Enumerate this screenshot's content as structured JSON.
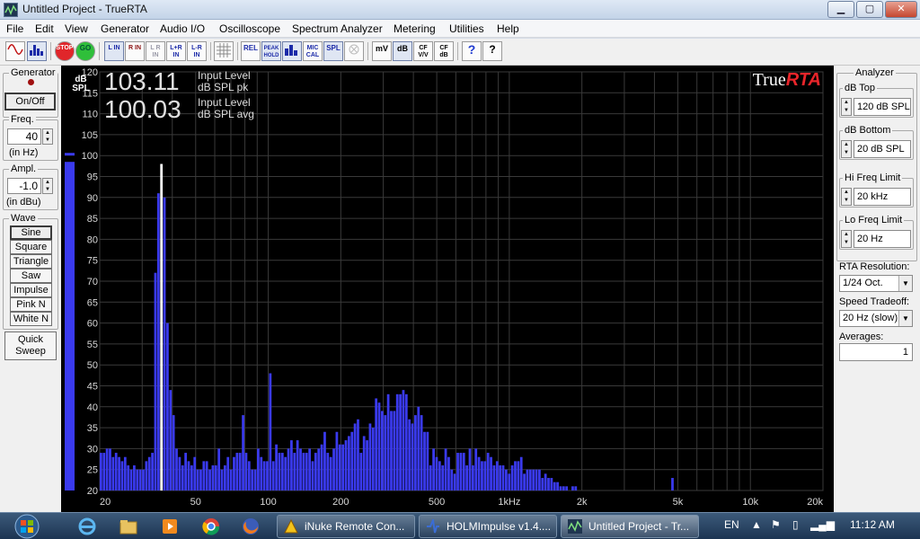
{
  "window": {
    "title": "Untitled Project - TrueRTA"
  },
  "menu": [
    "File",
    "Edit",
    "View",
    "Generator",
    "Audio I/O",
    "Oscilloscope",
    "Spectrum Analyzer",
    "Metering",
    "Utilities",
    "Help"
  ],
  "toolbar": {
    "stop": "STOP",
    "go": "GO",
    "l_in": "L IN",
    "r_in": "R IN",
    "lr_in": "L R IN",
    "lplusr_in": "L+R IN",
    "lminusr_in": "L-R IN",
    "rel": "REL",
    "peak_hold": "PEAK HOLD",
    "mic_cal": "MIC CAL",
    "spl": "SPL",
    "mv": "mV",
    "db": "dB",
    "cf_vv": "CF V/V",
    "cf_db": "CF dB",
    "help": "?",
    "whats_this": "?"
  },
  "generator": {
    "title": "Generator",
    "on_off": "On/Off",
    "freq_title": "Freq.",
    "freq_value": "40",
    "freq_unit": "(in Hz)",
    "ampl_title": "Ampl.",
    "ampl_value": "-1.0",
    "ampl_unit": "(in dBu)",
    "wave_title": "Wave",
    "waves": [
      "Sine",
      "Square",
      "Triangle",
      "Saw",
      "Impulse",
      "Pink N",
      "White N"
    ],
    "selected_wave": "Sine",
    "quick_sweep_1": "Quick",
    "quick_sweep_2": "Sweep"
  },
  "readouts": {
    "peak_value": "103.11",
    "peak_label_1": "Input Level",
    "peak_label_2": "dB SPL pk",
    "avg_value": "100.03",
    "avg_label_1": "Input Level",
    "avg_label_2": "dB SPL avg",
    "brand_true": "True",
    "brand_rta": "RTA"
  },
  "level_meter": {
    "label_1": "dB",
    "label_2": "SPL",
    "value": 98.5,
    "marker": 100
  },
  "analyzer": {
    "title": "Analyzer",
    "db_top_label": "dB Top",
    "db_top_value": "120 dB SPL",
    "db_bottom_label": "dB Bottom",
    "db_bottom_value": "20 dB SPL",
    "hi_freq_label": "Hi Freq Limit",
    "hi_freq_value": "20 kHz",
    "lo_freq_label": "Lo Freq Limit",
    "lo_freq_value": "20 Hz",
    "resolution_label": "RTA Resolution:",
    "resolution_value": "1/24 Oct.",
    "speed_label": "Speed Tradeoff:",
    "speed_value": "20 Hz (slow)",
    "averages_label": "Averages:",
    "averages_value": "1"
  },
  "taskbar": {
    "tasks": [
      "iNuke Remote Con...",
      "HOLMImpulse v1.4....",
      "Untitled Project - Tr..."
    ],
    "lang": "EN",
    "clock": "11:12 AM"
  },
  "colors": {
    "bars": "#3a3aee",
    "peak_marker": "#ffffff",
    "grid": "#3a3a3a",
    "background": "#000000"
  },
  "chart_data": {
    "type": "bar",
    "x_scale": "log",
    "xlim": [
      20,
      20000
    ],
    "ylim": [
      20,
      120
    ],
    "y_ticks": [
      20,
      25,
      30,
      35,
      40,
      45,
      50,
      55,
      60,
      65,
      70,
      75,
      80,
      85,
      90,
      95,
      100,
      105,
      110,
      115,
      120
    ],
    "x_ticks": [
      {
        "label": "20",
        "f": 20
      },
      {
        "label": "50",
        "f": 50
      },
      {
        "label": "100",
        "f": 100
      },
      {
        "label": "200",
        "f": 200
      },
      {
        "label": "500",
        "f": 500
      },
      {
        "label": "1kHz",
        "f": 1000
      },
      {
        "label": "2k",
        "f": 2000
      },
      {
        "label": "5k",
        "f": 5000
      },
      {
        "label": "10k",
        "f": 10000
      },
      {
        "label": "20k",
        "f": 20000
      }
    ],
    "resolution_bands_per_octave": 24,
    "series": [
      {
        "values": [
          29,
          29,
          30,
          30,
          28,
          29,
          28,
          27,
          28,
          26,
          25,
          26,
          25,
          25,
          25,
          27,
          28,
          29,
          72,
          91,
          98,
          90,
          60,
          44,
          38,
          30,
          28,
          26,
          29,
          27,
          26,
          28,
          25,
          25,
          27,
          27,
          25,
          26,
          26,
          30,
          25,
          26,
          28,
          25,
          28,
          29,
          29,
          38,
          29,
          27,
          25,
          25,
          30,
          28,
          27,
          27,
          48,
          27,
          31,
          29,
          29,
          28,
          30,
          32,
          29,
          32,
          30,
          29,
          29,
          30,
          27,
          29,
          30,
          31,
          34,
          29,
          28,
          30,
          34,
          31,
          31,
          32,
          33,
          34,
          36,
          37,
          29,
          33,
          32,
          36,
          35,
          42,
          41,
          39,
          38,
          43,
          39,
          39,
          43,
          43,
          44,
          43,
          37,
          36,
          38,
          40,
          38,
          34,
          34,
          26,
          30,
          28,
          27,
          26,
          30,
          28,
          25,
          24,
          29,
          29,
          29,
          26,
          30,
          26,
          30,
          28,
          27,
          27,
          29,
          28,
          26,
          27,
          26,
          26,
          25,
          24,
          26,
          27,
          27,
          28,
          24,
          25,
          25,
          25,
          25,
          25,
          23,
          24,
          23,
          23,
          22,
          22,
          21,
          21,
          21,
          20,
          21,
          21,
          20,
          20,
          20,
          20,
          20,
          20,
          20,
          20,
          20,
          20,
          20,
          20,
          20,
          20,
          20,
          20,
          20,
          20,
          20,
          20,
          20,
          20,
          20,
          20,
          20,
          20,
          20,
          20,
          20,
          20,
          20,
          23,
          20,
          20,
          20,
          20,
          20,
          20,
          20,
          20,
          20,
          20,
          20,
          20,
          20,
          20,
          20,
          20,
          20,
          20,
          20,
          20,
          20,
          20,
          20,
          20,
          20,
          20,
          20,
          20,
          20,
          20,
          20,
          20,
          20,
          20,
          20,
          20,
          20,
          20,
          20,
          20,
          20,
          20,
          20,
          20,
          20,
          20
        ]
      }
    ],
    "peak_hold_bin": 20
  }
}
